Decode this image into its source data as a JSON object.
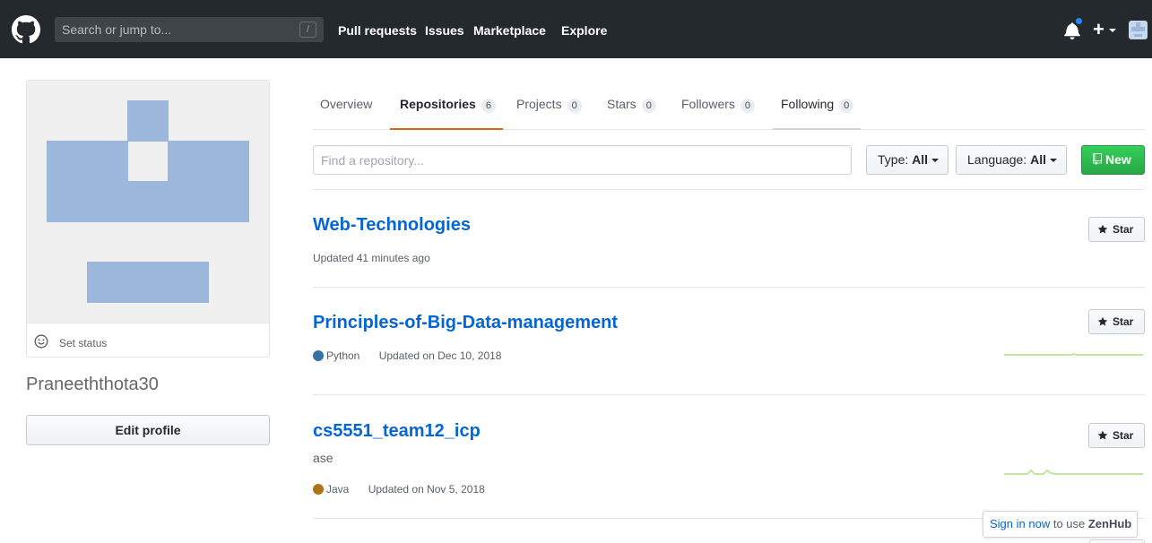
{
  "header": {
    "search_placeholder": "Search or jump to...",
    "search_shortcut": "/",
    "nav": [
      "Pull requests",
      "Issues",
      "Marketplace",
      "Explore"
    ],
    "plus_label": "+",
    "notification_dot_color": "#2188ff"
  },
  "profile": {
    "set_status_label": "Set status",
    "username": "Praneeththota30",
    "edit_profile_label": "Edit profile"
  },
  "tabs": [
    {
      "label": "Overview",
      "count": null
    },
    {
      "label": "Repositories",
      "count": "6"
    },
    {
      "label": "Projects",
      "count": "0"
    },
    {
      "label": "Stars",
      "count": "0"
    },
    {
      "label": "Followers",
      "count": "0"
    },
    {
      "label": "Following",
      "count": "0"
    }
  ],
  "filter": {
    "find_placeholder": "Find a repository...",
    "type_label": "Type:",
    "type_value": "All",
    "language_label": "Language:",
    "language_value": "All",
    "new_label": "New"
  },
  "repos": [
    {
      "name": "Web-Technologies",
      "description": "",
      "language": "",
      "language_color": "",
      "updated": "Updated 41 minutes ago",
      "star_label": "Star"
    },
    {
      "name": "Principles-of-Big-Data-management",
      "description": "",
      "language": "Python",
      "language_color": "#3572A5",
      "updated": "Updated on Dec 10, 2018",
      "star_label": "Star"
    },
    {
      "name": "cs5551_team12_icp",
      "description": "ase",
      "language": "Java",
      "language_color": "#b07219",
      "updated": "Updated on Nov 5, 2018",
      "star_label": "Star"
    }
  ],
  "zenhub": {
    "link_text": "Sign in now",
    "middle_text": " to use ",
    "brand": "ZenHub"
  },
  "colors": {
    "header_bg": "#24292e",
    "link": "#0366d6",
    "selected_tab_accent": "#e36209",
    "new_button": "#28a745",
    "sparkline": "#c2e5a0"
  }
}
